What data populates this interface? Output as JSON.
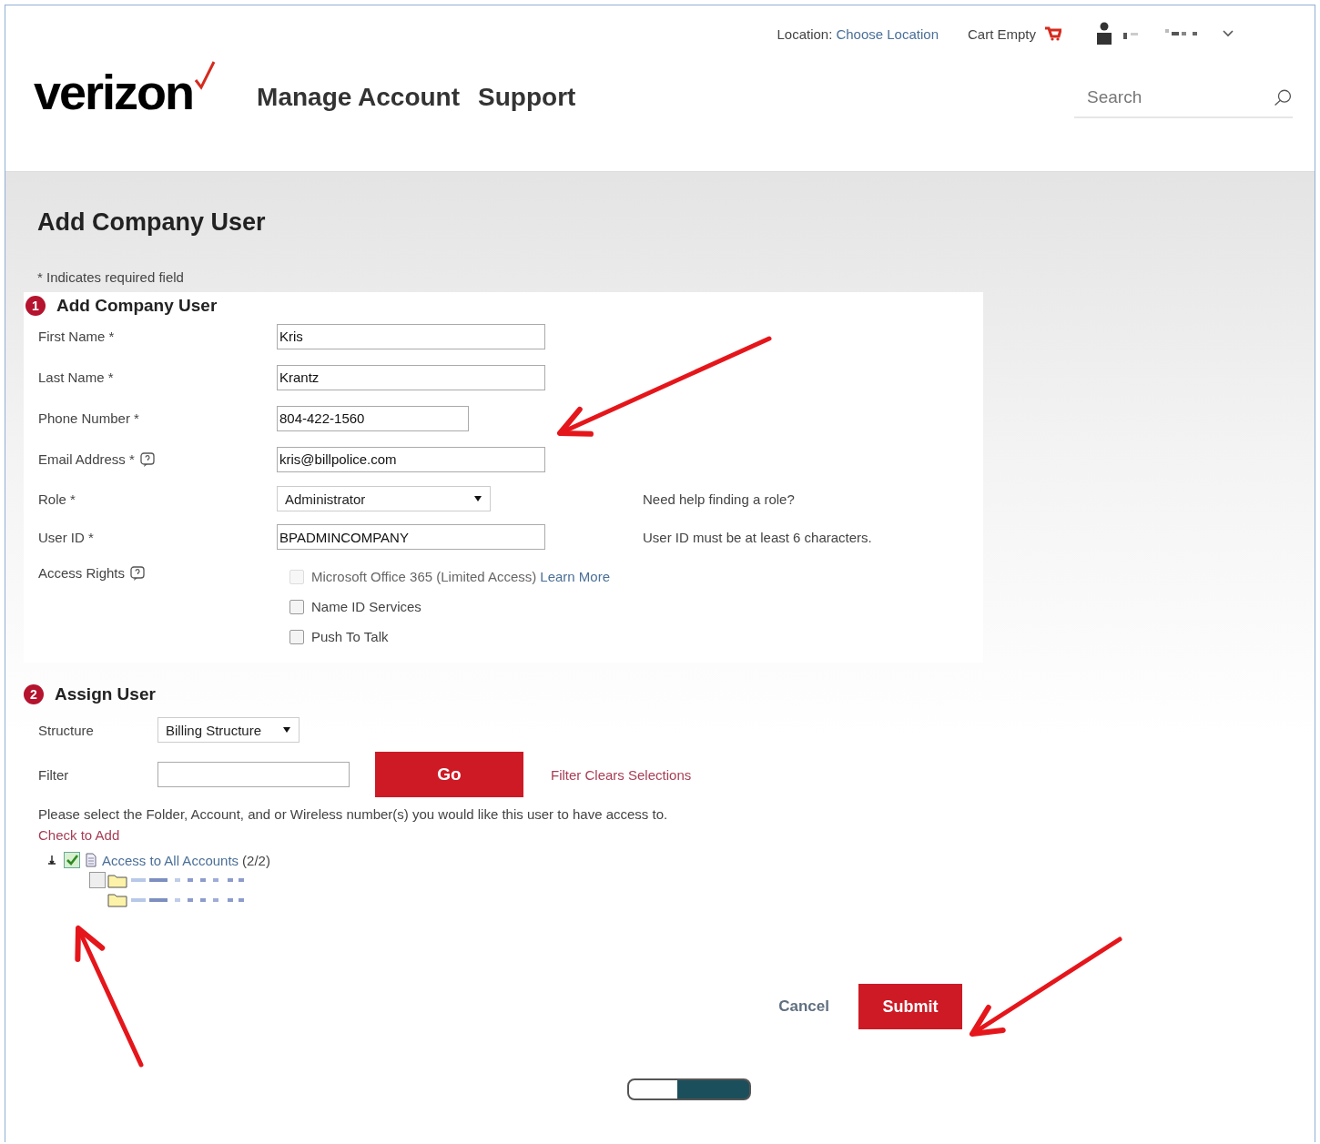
{
  "header": {
    "location_label": "Location:",
    "location_link": "Choose Location",
    "cart": "Cart Empty",
    "logo": "verizon",
    "nav": [
      "Manage Account",
      "Support"
    ],
    "search": {
      "placeholder": "Search"
    }
  },
  "page_title": "Add Company User",
  "required_note": "* Indicates required field",
  "section1": {
    "number": "1",
    "title": "Add Company User",
    "fields": [
      {
        "label": "First Name *",
        "kind": "text",
        "value": "Kris"
      },
      {
        "label": "Last Name *",
        "kind": "text",
        "value": "Krantz"
      },
      {
        "label": "Phone Number *",
        "kind": "text",
        "value": "804-422-1560"
      },
      {
        "label": "Email Address *",
        "kind": "text",
        "value": "kris@billpolice.com",
        "help": true
      },
      {
        "label": "Role *",
        "kind": "select",
        "value": "Administrator",
        "help_link": "Need help finding a role?"
      },
      {
        "label": "User ID *",
        "kind": "text",
        "value": "BPADMINCOMPANY",
        "note": "User ID must be at least 6 characters."
      }
    ],
    "access_rights": {
      "label": "Access Rights",
      "help": true,
      "options": [
        {
          "label": "Microsoft Office 365 (Limited Access)",
          "link": "Learn More",
          "checked": false,
          "disabled": true
        },
        {
          "label": "Name ID Services",
          "checked": false,
          "disabled": false
        },
        {
          "label": "Push To Talk",
          "checked": false,
          "disabled": false
        }
      ]
    }
  },
  "section2": {
    "number": "2",
    "title": "Assign User",
    "structure_label": "Structure",
    "structure_value": "Billing Structure",
    "filter_label": "Filter",
    "go": "Go",
    "filter_note": "Filter Clears Selections",
    "instructions": "Please select the Folder, Account, and or Wireless number(s) you would like this user to have access to.",
    "check_to_add": "Check to Add",
    "tree": {
      "label": "Access to All Accounts",
      "count": "(2/2)",
      "checked": true,
      "expanded": true,
      "children": [
        {
          "kind": "folder",
          "checked": false
        },
        {
          "kind": "folder"
        }
      ]
    }
  },
  "buttons": {
    "cancel": "Cancel",
    "submit": "Submit"
  }
}
